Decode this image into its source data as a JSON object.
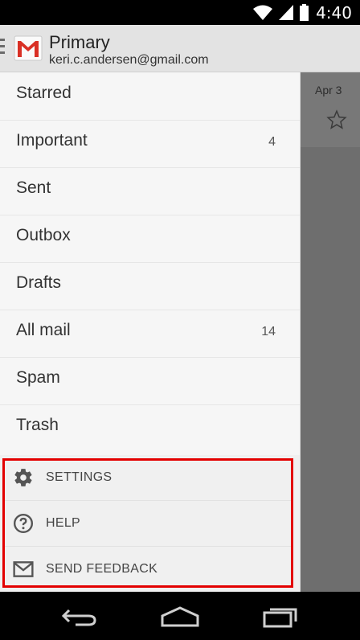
{
  "status": {
    "time": "4:40"
  },
  "header": {
    "title": "Primary",
    "account": "keri.c.andersen@gmail.com"
  },
  "drawer": {
    "items": [
      {
        "label": "Starred",
        "count": ""
      },
      {
        "label": "Important",
        "count": "4"
      },
      {
        "label": "Sent",
        "count": ""
      },
      {
        "label": "Outbox",
        "count": ""
      },
      {
        "label": "Drafts",
        "count": ""
      },
      {
        "label": "All mail",
        "count": "14"
      },
      {
        "label": "Spam",
        "count": ""
      },
      {
        "label": "Trash",
        "count": ""
      }
    ],
    "bottom": [
      {
        "label": "SETTINGS",
        "icon": "gear-icon"
      },
      {
        "label": "HELP",
        "icon": "help-icon"
      },
      {
        "label": "SEND FEEDBACK",
        "icon": "mail-icon"
      }
    ]
  },
  "background": {
    "date": "Apr 3"
  },
  "colors": {
    "highlight": "#e30000",
    "gmail_red": "#d93025"
  }
}
